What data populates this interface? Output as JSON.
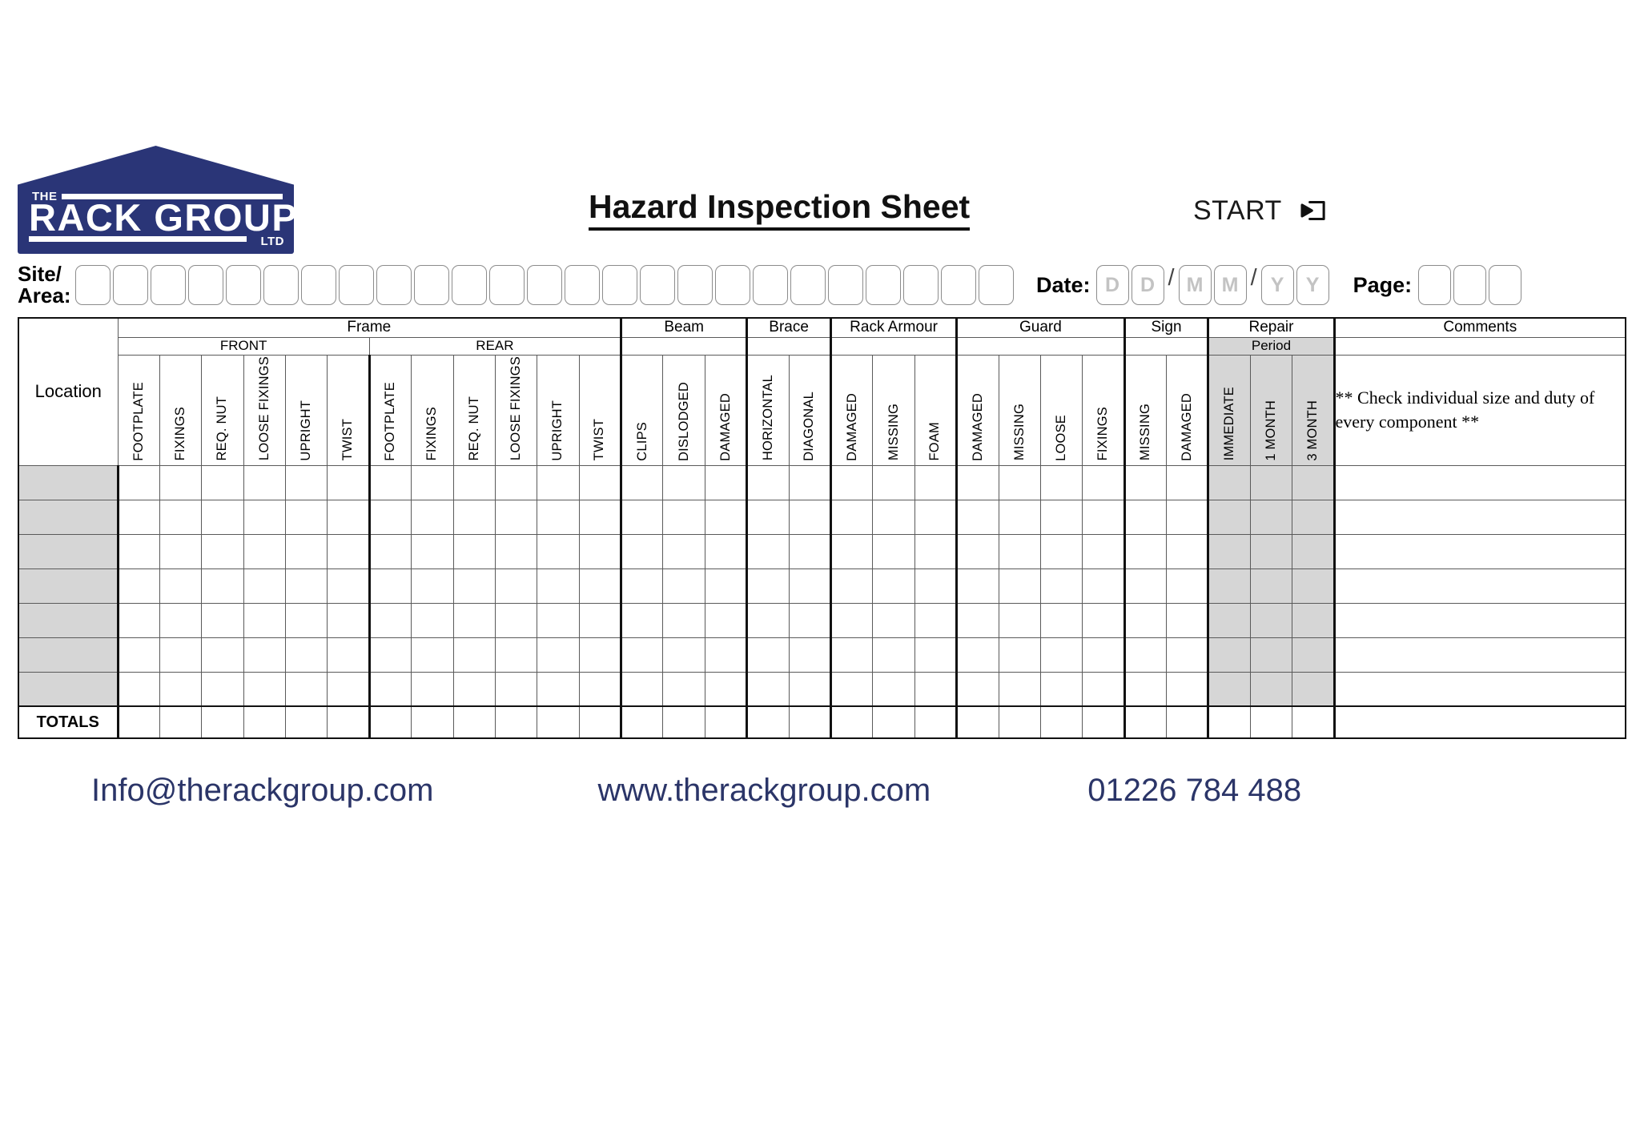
{
  "brand": {
    "logo_the": "THE",
    "logo_main": "RACK GROUP",
    "logo_ltd": "LTD",
    "navy": "#2a3577"
  },
  "header": {
    "title": "Hazard Inspection Sheet",
    "start_label": "START",
    "start_icon": "enter-arrow-box-icon"
  },
  "form": {
    "site_area_label_line1": "Site/",
    "site_area_label_line2": "Area:",
    "site_area_boxes": 25,
    "site_area_value": "",
    "date_label": "Date:",
    "date_placeholders": [
      "D",
      "D",
      "M",
      "M",
      "Y",
      "Y"
    ],
    "separator": "/",
    "page_label": "Page:",
    "page_boxes": 3,
    "page_value": ""
  },
  "table": {
    "location_header": "Location",
    "groups": [
      {
        "label": "Frame",
        "span": 12
      },
      {
        "label": "Beam",
        "span": 3
      },
      {
        "label": "Brace",
        "span": 2
      },
      {
        "label": "Rack Armour",
        "span": 3
      },
      {
        "label": "Guard",
        "span": 4
      },
      {
        "label": "Sign",
        "span": 2
      },
      {
        "label": "Repair",
        "span": 3
      },
      {
        "label": "Comments",
        "span": 1
      }
    ],
    "subgroups": [
      {
        "label": "FRONT",
        "span": 6
      },
      {
        "label": "REAR",
        "span": 6
      },
      {
        "label": "",
        "span": 3
      },
      {
        "label": "",
        "span": 2
      },
      {
        "label": "",
        "span": 3
      },
      {
        "label": "",
        "span": 4
      },
      {
        "label": "",
        "span": 2
      },
      {
        "label": "Period",
        "span": 3
      },
      {
        "label": "",
        "span": 1
      }
    ],
    "columns": [
      "FOOTPLATE",
      "FIXINGS",
      "REQ. NUT",
      "LOOSE FIXINGS",
      "UPRIGHT",
      "TWIST",
      "FOOTPLATE",
      "FIXINGS",
      "REQ. NUT",
      "LOOSE FIXINGS",
      "UPRIGHT",
      "TWIST",
      "CLIPS",
      "DISLODGED",
      "DAMAGED",
      "HORIZONTAL",
      "DIAGONAL",
      "DAMAGED",
      "MISSING",
      "FOAM",
      "DAMAGED",
      "MISSING",
      "LOOSE",
      "FIXINGS",
      "MISSING",
      "DAMAGED",
      "IMMEDIATE",
      "1 MONTH",
      "3 MONTH"
    ],
    "comments_note": "** Check individual size and duty of every component **",
    "data_rows": 7,
    "row_values": [
      {
        "location": "",
        "cells": []
      },
      {
        "location": "",
        "cells": []
      },
      {
        "location": "",
        "cells": []
      },
      {
        "location": "",
        "cells": []
      },
      {
        "location": "",
        "cells": []
      },
      {
        "location": "",
        "cells": []
      },
      {
        "location": "",
        "cells": []
      }
    ],
    "totals_label": "TOTALS"
  },
  "footer": {
    "email": "Info@therackgroup.com",
    "website": "www.therackgroup.com",
    "phone": "01226 784 488",
    "color": "#2b3568"
  }
}
